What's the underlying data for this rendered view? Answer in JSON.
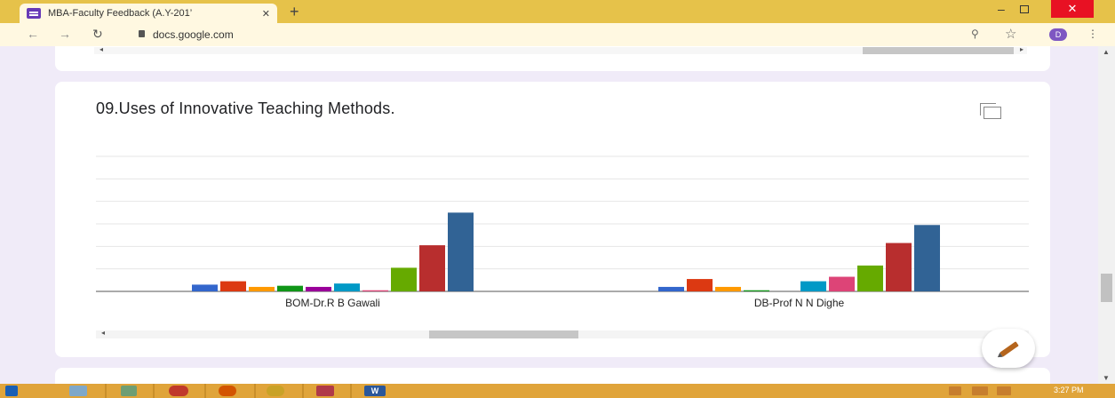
{
  "browser": {
    "tab_title": "MBA-Faculty Feedback (A.Y-201’",
    "tab_close": "✕",
    "new_tab": "+",
    "url": "docs.google.com",
    "profile_initial": "D",
    "window_close": "✕",
    "window_minimize": "–"
  },
  "question": {
    "title": "09.Uses of Innovative Teaching Methods."
  },
  "chart_data": {
    "type": "bar",
    "categories": [
      "BOM-Dr.R B Gawali",
      "DB-Prof N N Dighe"
    ],
    "series": [
      {
        "color": "#3366cc",
        "values": [
          6,
          4
        ]
      },
      {
        "color": "#dc3912",
        "values": [
          9,
          11
        ]
      },
      {
        "color": "#ff9900",
        "values": [
          4,
          4
        ]
      },
      {
        "color": "#109618",
        "values": [
          5,
          1
        ]
      },
      {
        "color": "#990099",
        "values": [
          4,
          0
        ]
      },
      {
        "color": "#0099c6",
        "values": [
          7,
          9
        ]
      },
      {
        "color": "#dd4477",
        "values": [
          1,
          13
        ]
      },
      {
        "color": "#66aa00",
        "values": [
          21,
          23
        ]
      },
      {
        "color": "#b82e2e",
        "values": [
          41,
          43
        ]
      },
      {
        "color": "#316395",
        "values": [
          70,
          59
        ]
      }
    ],
    "ylim": [
      0,
      120
    ],
    "grid": true,
    "legend": "none"
  },
  "taskbar": {
    "word_label": "W",
    "clock": "3:27 PM"
  }
}
